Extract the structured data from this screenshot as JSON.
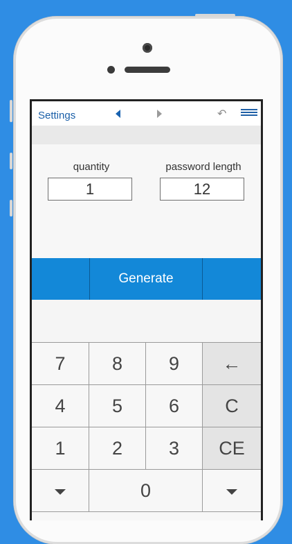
{
  "nav": {
    "settings": "Settings",
    "undo_icon": "↶"
  },
  "fields": {
    "quantity_label": "quantity",
    "quantity_value": "1",
    "length_label": "password length",
    "length_value": "12"
  },
  "generate_label": "Generate",
  "keys": {
    "k7": "7",
    "k8": "8",
    "k9": "9",
    "back": "←",
    "k4": "4",
    "k5": "5",
    "k6": "6",
    "clear": "C",
    "k1": "1",
    "k2": "2",
    "k3": "3",
    "clear_entry": "CE",
    "k0": "0"
  },
  "colors": {
    "background": "#2f8de4",
    "accent": "#1388d8"
  }
}
